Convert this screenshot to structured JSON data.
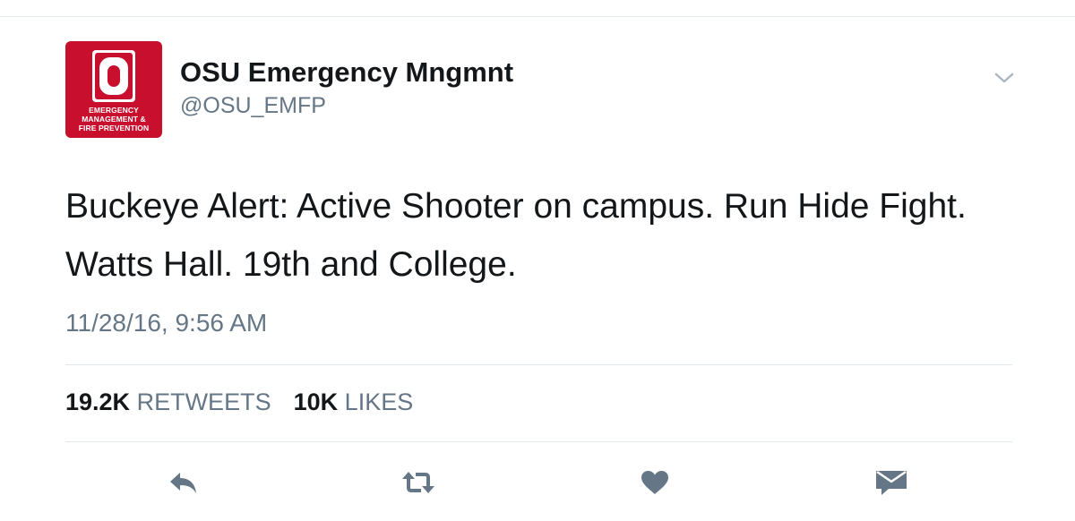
{
  "account": {
    "display_name": "OSU Emergency Mngmnt",
    "handle": "@OSU_EMFP",
    "avatar_caption": [
      "EMERGENCY",
      "MANAGEMENT &",
      "FIRE PREVENTION"
    ]
  },
  "tweet": {
    "text": "Buckeye Alert: Active Shooter on campus. Run Hide Fight. Watts Hall. 19th and College.",
    "timestamp": "11/28/16, 9:56 AM"
  },
  "stats": {
    "retweets_count": "19.2K",
    "retweets_label": "RETWEETS",
    "likes_count": "10K",
    "likes_label": "LIKES"
  },
  "actions": [
    "reply-icon",
    "retweet-icon",
    "like-icon",
    "direct-message-icon"
  ],
  "colors": {
    "brand_red": "#c8102e",
    "text_primary": "#14171a",
    "text_secondary": "#657786",
    "icon_gray": "#657786",
    "divider": "#e1e8ed"
  }
}
